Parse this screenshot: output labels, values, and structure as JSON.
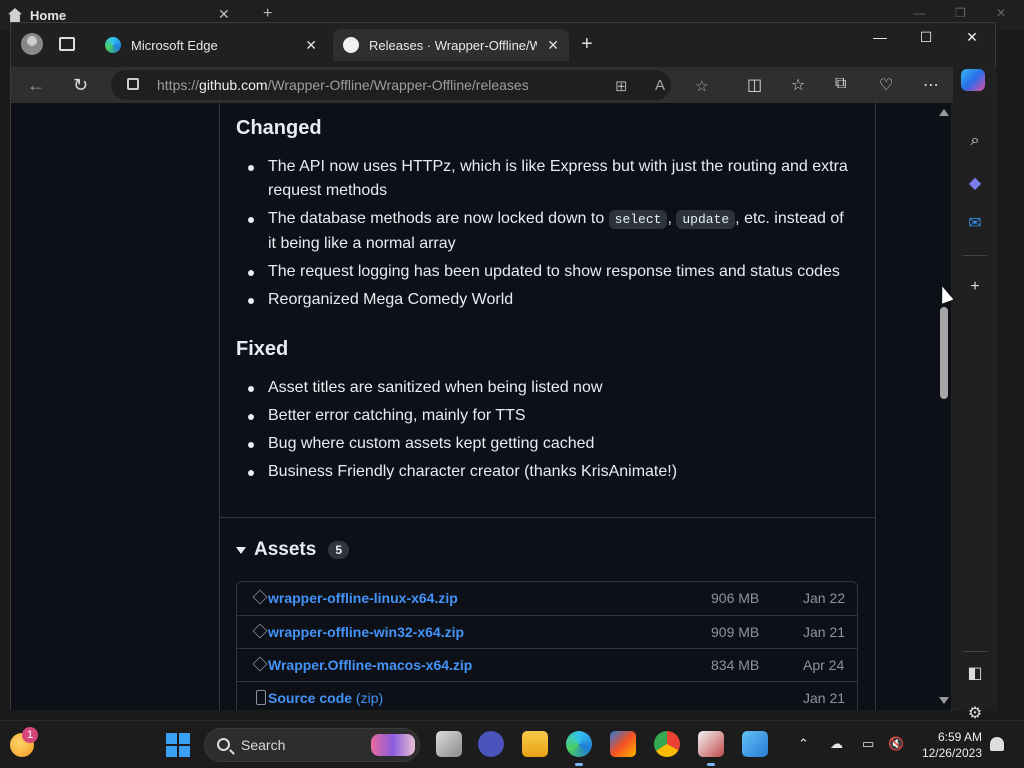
{
  "background_window": {
    "tab_label": "Home"
  },
  "browser": {
    "tabs": [
      {
        "label": "Microsoft Edge",
        "active": false
      },
      {
        "label": "Releases · Wrapper-Offline/Wrap",
        "active": true
      }
    ],
    "url": {
      "scheme": "https://",
      "host": "github.com",
      "path": "/Wrapper-Offline/Wrapper-Offline/releases"
    }
  },
  "release_notes": {
    "changed": {
      "heading": "Changed",
      "items": [
        "The API now uses HTTPz, which is like Express but with just the routing and extra request methods",
        {
          "before": "The database methods are now locked down to ",
          "code1": "select",
          "sep": ", ",
          "code2": "update",
          "after": ", etc. instead of it being like a normal array"
        },
        "The request logging has been updated to show response times and status codes",
        "Reorganized Mega Comedy World"
      ]
    },
    "fixed": {
      "heading": "Fixed",
      "items": [
        "Asset titles are sanitized when being listed now",
        "Better error catching, mainly for TTS",
        "Bug where custom assets kept getting cached",
        "Business Friendly character creator (thanks KrisAnimate!)"
      ]
    }
  },
  "assets": {
    "heading": "Assets",
    "count": "5",
    "rows": [
      {
        "name": "wrapper-offline-linux-x64.zip",
        "size": "906 MB",
        "date": "Jan 22",
        "icon": "package-icon"
      },
      {
        "name": "wrapper-offline-win32-x64.zip",
        "size": "909 MB",
        "date": "Jan 21",
        "icon": "package-icon"
      },
      {
        "name": "Wrapper.Offline-macos-x64.zip",
        "size": "834 MB",
        "date": "Apr 24",
        "icon": "package-icon"
      },
      {
        "name": "Source code",
        "suffix": "(zip)",
        "size": "",
        "date": "Jan 21",
        "icon": "zip-file-icon"
      }
    ]
  },
  "taskbar": {
    "search_label": "Search",
    "notification_badge": "1",
    "time": "6:59 AM",
    "date": "12/26/2023"
  },
  "colors": {
    "page_bg": "#0d1117",
    "link": "#4493f8",
    "text": "#e6edf3",
    "muted": "#8b949e"
  }
}
